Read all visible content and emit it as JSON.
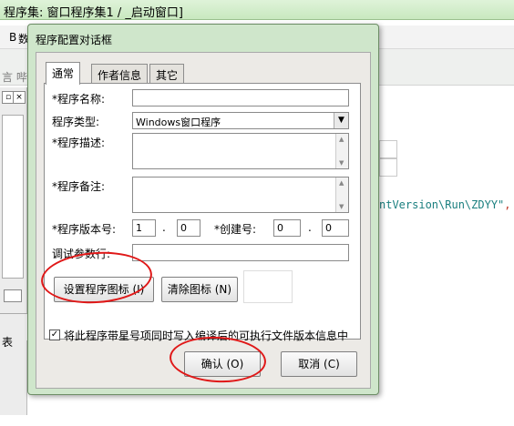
{
  "ide": {
    "title": "程序集: 窗口程序集1 / _启动窗口]",
    "menu_fragment": "B",
    "menu_fragment2": "数",
    "left_text": "言 哔",
    "left_box1": "×",
    "left_box2": "▫",
    "code_line": "ntVersion\\Run\\ZDYY\"",
    "code_tail": ", 取运",
    "bottom_text": "表"
  },
  "dialog": {
    "title": "程序配置对话框",
    "tabs": [
      {
        "label": "通常"
      },
      {
        "label": "作者信息"
      },
      {
        "label": "其它"
      }
    ],
    "fields": {
      "program_name_label": "*程序名称:",
      "program_name_value": "",
      "program_type_label": "程序类型:",
      "program_type_value": "Windows窗口程序",
      "program_desc_label": "*程序描述:",
      "program_desc_value": "",
      "program_note_label": "*程序备注:",
      "program_note_value": "",
      "version_label": "*程序版本号:",
      "version_major": "1",
      "version_minor": "0",
      "version_dot": ".",
      "build_label": "*创建号:",
      "build_major": "0",
      "build_minor": "0",
      "build_dot": ".",
      "debug_args_label": "调试参数行:",
      "debug_args_value": ""
    },
    "buttons": {
      "set_icon": "设置程序图标 (I)",
      "clear_icon": "清除图标 (N)",
      "ok": "确认 (O)",
      "cancel": "取消 (C)"
    },
    "checkbox": {
      "checked": true,
      "mark": "✓",
      "label": "将此程序带星号项同时写入编译后的可执行文件版本信息中"
    }
  },
  "colors": {
    "dialog_frame": "#cfe6cb",
    "annotation_red": "#e01818"
  }
}
